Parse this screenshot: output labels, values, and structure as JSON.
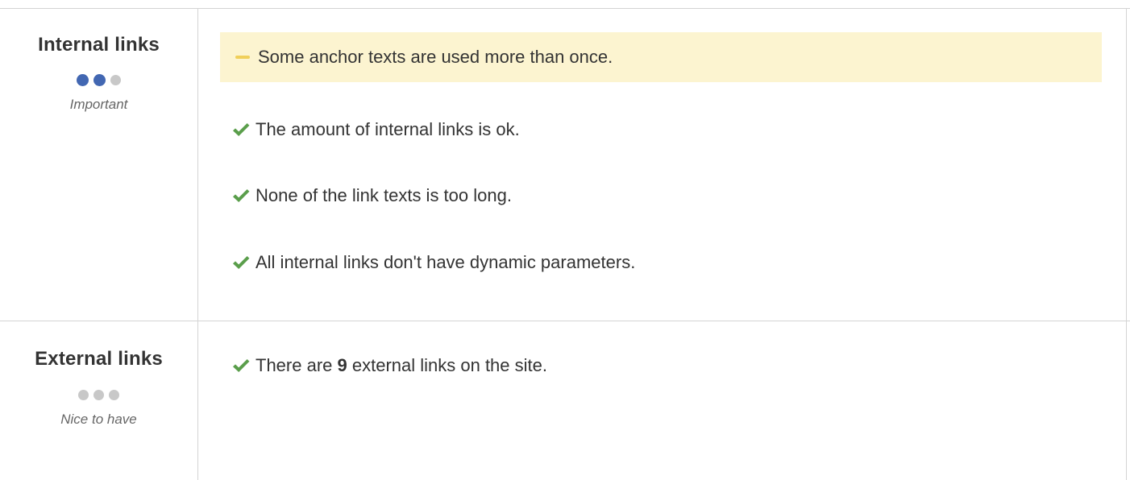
{
  "sections": [
    {
      "title": "Internal links",
      "priority": "Important",
      "importance_level": 2,
      "importance_max": 3,
      "warning": "Some anchor texts are used more than once.",
      "checks": [
        "The amount of internal links is ok.",
        "None of the link texts is too long.",
        "All internal links don't have dynamic parameters."
      ]
    },
    {
      "title": "External links",
      "priority": "Nice to have",
      "importance_level": 0,
      "importance_max": 3,
      "check_parts": {
        "prefix": "There are ",
        "count": "9",
        "suffix": " external links on the site."
      }
    }
  ],
  "colors": {
    "check": "#5a9e4b",
    "dot_active": "#4267b2",
    "dot_inactive": "#c8c8c8",
    "warning_bg": "#fcf4d0",
    "warning_dash": "#f0cf5a",
    "border": "#d4d4d4"
  },
  "icons": {
    "check": "check-icon",
    "warning": "warning-dash-icon",
    "importance": "importance-dot-icon"
  }
}
